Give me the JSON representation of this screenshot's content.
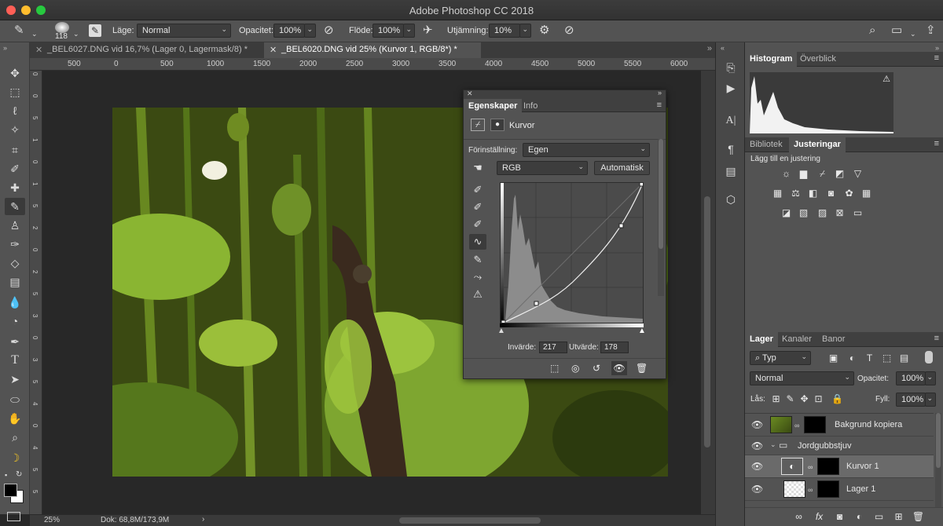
{
  "app": {
    "title": "Adobe Photoshop CC 2018"
  },
  "options": {
    "brush_size": "118",
    "mode_label": "Läge:",
    "mode_value": "Normal",
    "opacity_label": "Opacitet:",
    "opacity_value": "100%",
    "flow_label": "Flöde:",
    "flow_value": "100%",
    "smoothing_label": "Utjämning:",
    "smoothing_value": "10%"
  },
  "tabs": [
    {
      "label": "_BEL6027.DNG vid 16,7% (Lager 0, Lagermask/8) *"
    },
    {
      "label": "_BEL6020.DNG vid 25% (Kurvor 1, RGB/8*) *"
    }
  ],
  "ruler": {
    "top": [
      "500",
      "0",
      "500",
      "1000",
      "1500",
      "2000",
      "2500",
      "3000",
      "3500",
      "4000",
      "4500",
      "5000",
      "5500",
      "6000"
    ],
    "left": [
      "0",
      "0",
      "5",
      "1",
      "0",
      "1",
      "5",
      "2",
      "0",
      "2",
      "5",
      "3",
      "0",
      "3",
      "5",
      "4",
      "0",
      "4",
      "5",
      "5"
    ]
  },
  "status": {
    "zoom": "25%",
    "doc": "Dok: 68,8M/173,9M"
  },
  "properties": {
    "tab_props": "Egenskaper",
    "tab_info": "Info",
    "layer_type": "Kurvor",
    "preset_label": "Förinställning:",
    "preset_value": "Egen",
    "channel_value": "RGB",
    "auto_button": "Automatisk",
    "input_label": "Invärde:",
    "input_value": "217",
    "output_label": "Utvärde:",
    "output_value": "178"
  },
  "panels": {
    "histogram_tab": "Histogram",
    "overview_tab": "Överblick",
    "library_tab": "Bibliotek",
    "adjust_tab": "Justeringar",
    "adjust_hint": "Lägg till en justering",
    "layers_tab": "Lager",
    "channels_tab": "Kanaler",
    "paths_tab": "Banor",
    "filter_value": "Typ",
    "blend_value": "Normal",
    "opacity_label": "Opacitet:",
    "opacity_value": "100%",
    "lock_label": "Lås:",
    "fill_label": "Fyll:",
    "fill_value": "100%"
  },
  "layers": [
    {
      "name": "Bakgrund kopiera"
    },
    {
      "name": "Jordgubbstjuv"
    },
    {
      "name": "Kurvor 1"
    },
    {
      "name": "Lager 1"
    }
  ],
  "colors": {
    "accent": "#1e6fd9",
    "panel": "#535353",
    "dark": "#282828"
  }
}
